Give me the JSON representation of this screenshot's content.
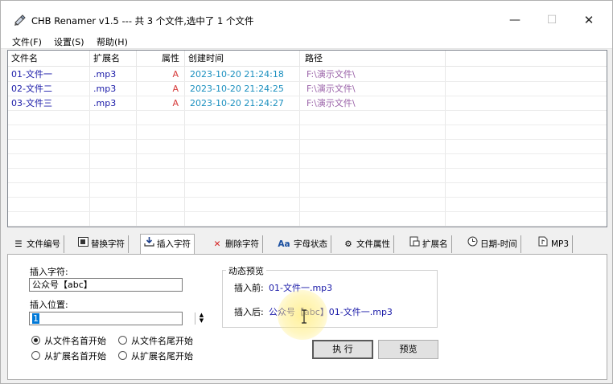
{
  "window": {
    "title": "CHB Renamer v1.5 --- 共 3 个文件,选中了 1 个文件",
    "minimize": "—",
    "maximize": "☐",
    "close": "✕"
  },
  "menu": [
    "文件(F)",
    "设置(S)",
    "帮助(H)"
  ],
  "list": {
    "headers": [
      "文件名",
      "扩展名",
      "属性",
      "创建时间",
      "路径"
    ],
    "rows": [
      {
        "name": "01-文件一",
        "ext": ".mp3",
        "attr": "A",
        "time": "2023-10-20 21:24:18",
        "path": "F:\\演示文件\\"
      },
      {
        "name": "02-文件二",
        "ext": ".mp3",
        "attr": "A",
        "time": "2023-10-20 21:24:25",
        "path": "F:\\演示文件\\"
      },
      {
        "name": "03-文件三",
        "ext": ".mp3",
        "attr": "A",
        "time": "2023-10-20 21:24:27",
        "path": "F:\\演示文件\\"
      }
    ]
  },
  "tabs": [
    {
      "label": "文件编号",
      "icon": "list-numbered-icon"
    },
    {
      "label": "替换字符",
      "icon": "replace-icon"
    },
    {
      "label": "插入字符",
      "icon": "insert-icon"
    },
    {
      "label": "删除字符",
      "icon": "delete-x-icon"
    },
    {
      "label": "字母状态",
      "icon": "letter-case-icon",
      "glyph": "Aa"
    },
    {
      "label": "文件属性",
      "icon": "gear-icon"
    },
    {
      "label": "扩展名",
      "icon": "extension-icon"
    },
    {
      "label": "日期-时间",
      "icon": "clock-icon"
    },
    {
      "label": "MP3",
      "icon": "music-file-icon"
    }
  ],
  "insert_panel": {
    "insert_chars_label": "插入字符:",
    "insert_chars_value": "公众号【abc】",
    "insert_pos_label": "插入位置:",
    "insert_pos_value": "1",
    "radios": [
      {
        "label": "从文件名首开始",
        "checked": true
      },
      {
        "label": "从文件名尾开始",
        "checked": false
      },
      {
        "label": "从扩展名首开始",
        "checked": false
      },
      {
        "label": "从扩展名尾开始",
        "checked": false
      }
    ],
    "preview_group": "动态预览",
    "before_label": "插入前:",
    "before_value": "01-文件一.mp3",
    "after_label": "插入后:",
    "after_value": "公众号【abc】01-文件一.mp3",
    "execute_button": "执 行",
    "preview_button": "预览"
  },
  "colors": {
    "name_text": "#1a1aa8",
    "attr_text": "#d63a3a",
    "time_text": "#1a8fbf",
    "path_text": "#9a62a8"
  }
}
